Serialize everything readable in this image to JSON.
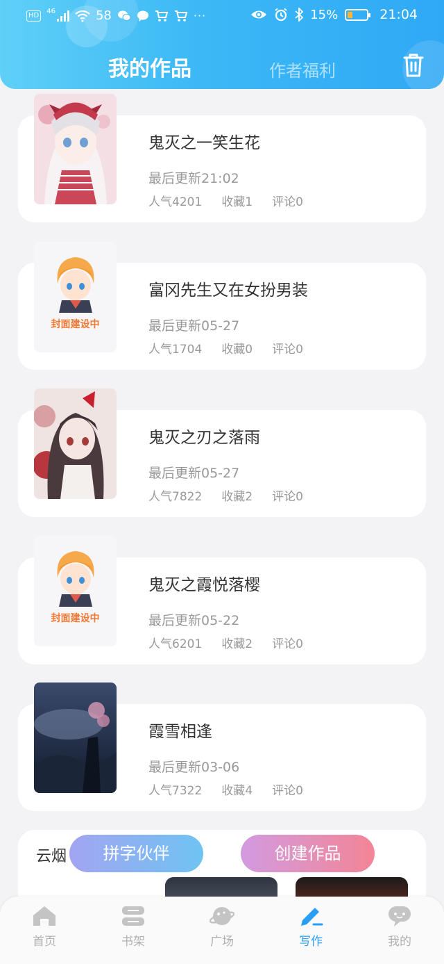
{
  "status_bar": {
    "left_badge": "HD",
    "network": "46",
    "notif_count": "58",
    "battery_pct": "15%",
    "time": "21:04",
    "icons_left": [
      "hd-icon",
      "signal-icon",
      "wifi-icon",
      "wechat-icon",
      "chat-icon",
      "cart-icon",
      "cart-icon",
      "more-icon"
    ],
    "icons_right": [
      "eye-icon",
      "alarm-icon",
      "bluetooth-icon",
      "battery-icon"
    ]
  },
  "header": {
    "tab_active": "我的作品",
    "tab_inactive": "作者福利",
    "trash_icon": "trash-icon"
  },
  "books": [
    {
      "title": "鬼灭之一笑生花",
      "updated": "最后更新21:02",
      "popularity": "人气4201",
      "favorites": "收藏1",
      "comments": "评论0",
      "cover": "anime-girl-red"
    },
    {
      "title": "富冈先生又在女扮男装",
      "updated": "最后更新05-27",
      "popularity": "人气1704",
      "favorites": "收藏0",
      "comments": "评论0",
      "cover": "placeholder",
      "cover_text": "封面建设中"
    },
    {
      "title": "鬼灭之刃之落雨",
      "updated": "最后更新05-27",
      "popularity": "人气7822",
      "favorites": "收藏2",
      "comments": "评论0",
      "cover": "anime-girl-dark"
    },
    {
      "title": "鬼灭之霞悦落樱",
      "updated": "最后更新05-22",
      "popularity": "人气6201",
      "favorites": "收藏2",
      "comments": "评论0",
      "cover": "placeholder",
      "cover_text": "封面建设中"
    },
    {
      "title": "霞雪相逢",
      "updated": "最后更新03-06",
      "popularity": "人气7322",
      "favorites": "收藏4",
      "comments": "评论0",
      "cover": "night-landscape"
    }
  ],
  "partial_card": {
    "title": "云烟"
  },
  "actions": {
    "partner": "拼字伙伴",
    "create": "创建作品"
  },
  "nav": [
    {
      "label": "首页",
      "icon": "home-icon",
      "active": false
    },
    {
      "label": "书架",
      "icon": "bookshelf-icon",
      "active": false
    },
    {
      "label": "广场",
      "icon": "planet-icon",
      "active": false
    },
    {
      "label": "写作",
      "icon": "pen-icon",
      "active": true
    },
    {
      "label": "我的",
      "icon": "profile-chat-icon",
      "active": false
    }
  ],
  "colors": {
    "header_start": "#5fd0f7",
    "header_end": "#2fa9f5",
    "accent": "#2a9df4"
  }
}
